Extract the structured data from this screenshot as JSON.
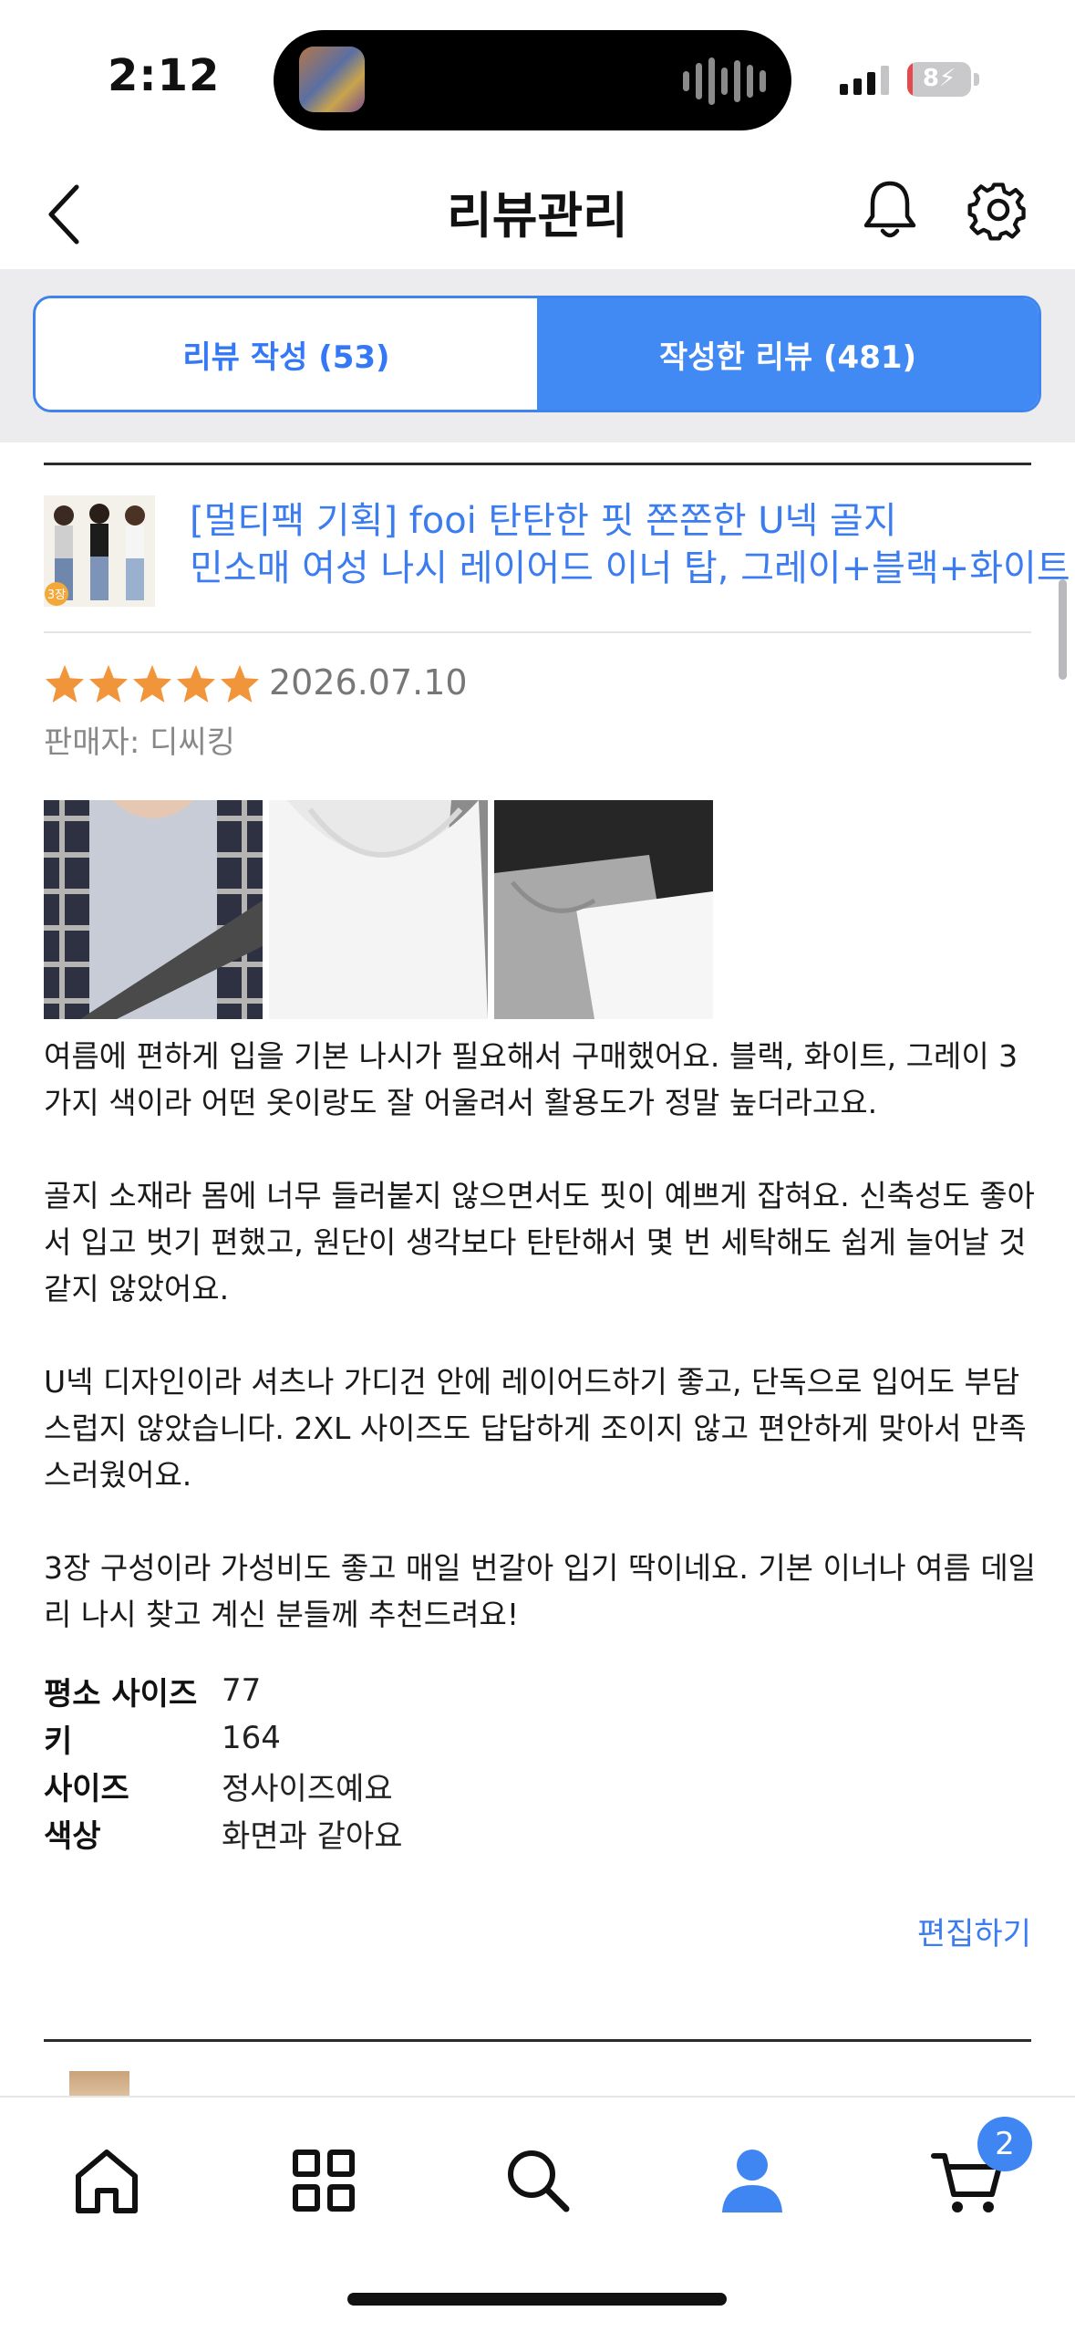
{
  "status_bar": {
    "time": "2:12",
    "battery": "8",
    "battery_level_percent": 8,
    "signal_bars_active": 3
  },
  "header": {
    "title": "리뷰관리"
  },
  "tabs": [
    {
      "label": "리뷰 작성 (53)",
      "selected": false
    },
    {
      "label": "작성한 리뷰 (481)",
      "selected": true
    }
  ],
  "review": {
    "product_name_line1": "[멀티팩 기획] fooi 탄탄한 핏 쫀쫀한 U넥 골지",
    "product_name_line2": "민소매 여성 나시 레이어드 이너 탑, 그레이+블랙+화이트",
    "thumb_badge": "3장",
    "rating": 5,
    "date": "2026.07.10",
    "seller": "판매자: 디씨킹",
    "body": [
      "여름에 편하게 입을 기본 나시가 필요해서 구매했어요. 블랙, 화이트, 그레이 3가지 색이라 어떤 옷이랑도 잘 어울려서 활용도가 정말 높더라고요.",
      "골지 소재라 몸에 너무 들러붙지 않으면서도 핏이 예쁘게 잡혀요. 신축성도 좋아서 입고 벗기 편했고, 원단이 생각보다 탄탄해서 몇 번 세탁해도 쉽게 늘어날 것 같지 않았어요.",
      "U넥 디자인이라 셔츠나 가디건 안에 레이어드하기 좋고, 단독으로 입어도 부담스럽지 않았습니다. 2XL 사이즈도 답답하게 조이지 않고 편안하게 맞아서 만족스러웠어요.",
      "3장 구성이라 가성비도 좋고 매일 번갈아 입기 딱이네요. 기본 이너나 여름 데일리 나시 찾고 계신 분들께 추천드려요!"
    ],
    "specs": [
      {
        "label": "평소 사이즈",
        "value": "77"
      },
      {
        "label": "키",
        "value": "164"
      },
      {
        "label": "사이즈",
        "value": "정사이즈예요"
      },
      {
        "label": "색상",
        "value": "화면과 같아요"
      }
    ],
    "edit_label": "편집하기"
  },
  "bottom_nav": {
    "items": [
      "home-icon",
      "grid-icon",
      "search-icon",
      "profile-icon",
      "cart-icon"
    ],
    "cart_badge": "2"
  },
  "colors": {
    "accent": "#4189f3",
    "link": "#3b7cf0",
    "star": "#f0953a"
  }
}
